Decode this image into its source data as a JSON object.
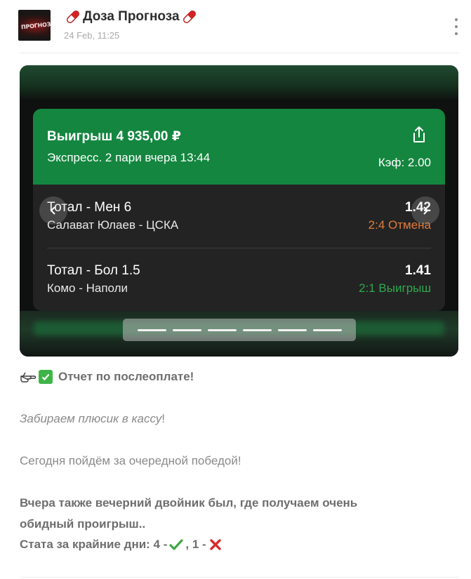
{
  "post": {
    "channel_name": "Доза Прогноза",
    "avatar_text": "ПРОГНОЗА",
    "time": "24 Feb, 11:25",
    "title_icon": "pill-icon",
    "menu_icon": "more-vertical-icon"
  },
  "bet": {
    "win_title": "Выигрыш 4 935,00 ₽",
    "express": "Экспресс. 2 пари вчера 13:44",
    "coef": "Кэф: 2.00",
    "header_color": "#14863f",
    "items": [
      {
        "market": "Тотал - Мен 6",
        "match": "Салават Юлаев - ЦСКА",
        "odd": "1.42",
        "result": "2:4 Отмена",
        "result_color": "#e17c3c"
      },
      {
        "market": "Тотал - Бол 1.5",
        "match": "Комо - Наполи",
        "odd": "1.41",
        "result": "2:1 Выигрыш",
        "result_color": "#2fa84f"
      }
    ]
  },
  "gallery": {
    "pages": 6,
    "prev_icon": "chevron-left-icon",
    "next_icon": "chevron-right-icon"
  },
  "text": {
    "report": "Отчет по послеоплате!",
    "italic_before": "Забираем плюсик в кассу",
    "italic_after": "!",
    "today": "Сегодня пойдём за очередной победой!",
    "yesterday_1": "Вчера также вечерний двойник был, где получаем очень",
    "yesterday_2": "обидный проигрыш..",
    "stats_prefix": "Стата за крайние дни: 4 -",
    "stats_mid": ", 1 -",
    "icons": [
      "pointing-hand-icon",
      "check-mark-button-icon",
      "check-mark-icon",
      "cross-mark-icon"
    ]
  }
}
